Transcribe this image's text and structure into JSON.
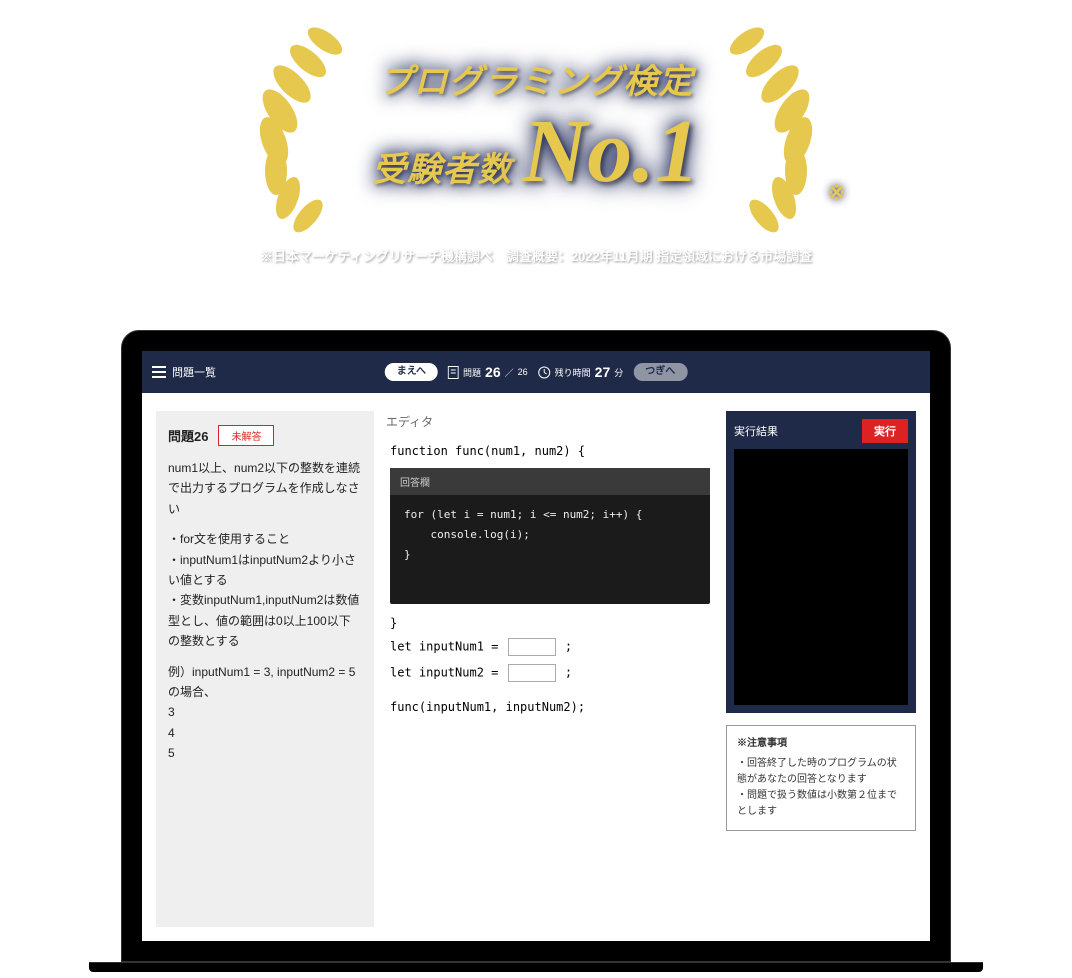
{
  "hero": {
    "line1": "プログラミング検定",
    "line2_sub": "受験者数",
    "line2_no1": "No.1",
    "asterisk": "※",
    "disclaimer": "※日本マーケティングリサーチ機構調べ　調査概要：2022年11月期 指定領域における市場調査"
  },
  "header": {
    "menu_label": "問題一覧",
    "prev_btn": "まえへ",
    "next_btn": "つぎへ",
    "q_label": "問題",
    "q_current": "26",
    "q_total": "26",
    "time_label": "残り時間",
    "time_value": "27",
    "time_unit": "分"
  },
  "question": {
    "title": "問題26",
    "status": "未解答",
    "body1": "num1以上、num2以下の整数を連続で出力するプログラムを作成しなさい",
    "body2": "・for文を使用すること\n・inputNum1はinputNum2より小さい値とする\n・変数inputNum1,inputNum2は数値型とし、値の範囲は0以上100以下の整数とする",
    "body3": "例）inputNum1 = 3, inputNum2 = 5 の場合、\n3\n4\n5"
  },
  "editor": {
    "title": "エディタ",
    "sig": "function func(num1, num2) {",
    "answer_header": "回答欄",
    "answer_code": "for (let i = num1; i <= num2; i++) {\n    console.log(i);\n}",
    "close": "}",
    "input1": "let inputNum1 = ",
    "input2": "let inputNum2 = ",
    "semi": " ;",
    "call": "func(inputNum1, inputNum2);"
  },
  "result": {
    "title": "実行結果",
    "run": "実行"
  },
  "notes": {
    "title": "※注意事項",
    "n1": "・回答終了した時のプログラムの状態があなたの回答となります",
    "n2": "・問題で扱う数値は小数第２位までとします"
  }
}
